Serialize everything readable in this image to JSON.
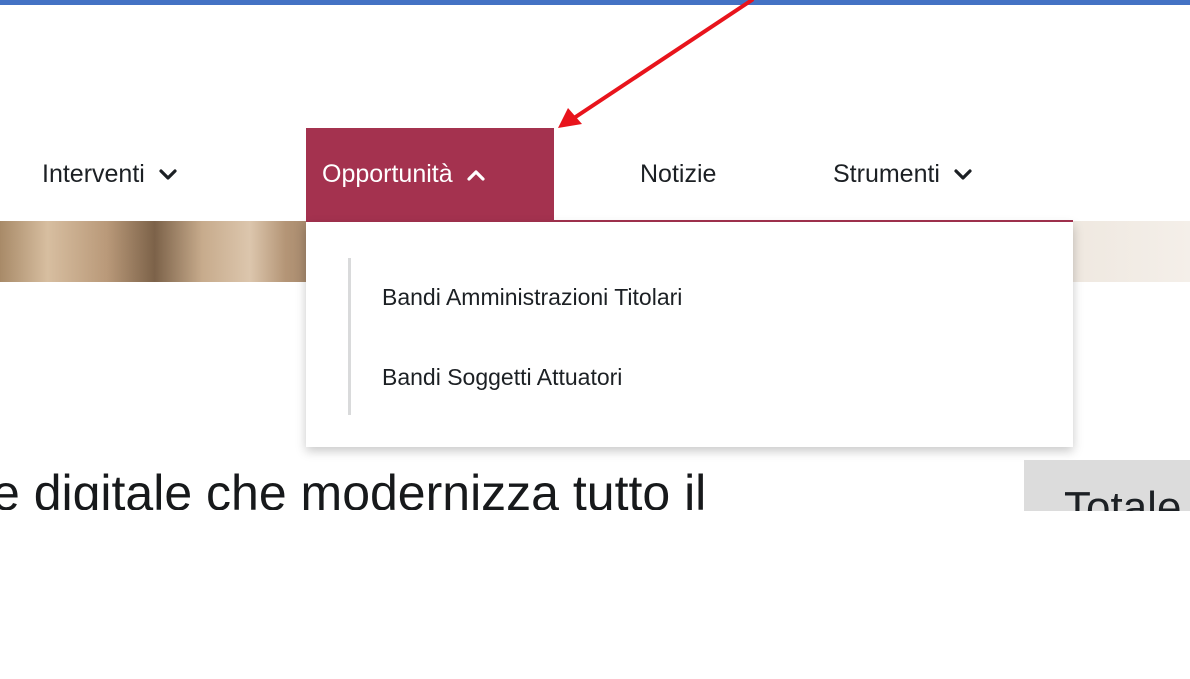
{
  "nav": {
    "items": [
      {
        "label": "Interventi",
        "chevron": "chevron-down-icon",
        "active": false
      },
      {
        "label": "Opportunità",
        "chevron": "chevron-up-icon",
        "active": true
      },
      {
        "label": "Notizie",
        "chevron": "",
        "active": false
      },
      {
        "label": "Strumenti",
        "chevron": "chevron-down-icon",
        "active": false
      }
    ]
  },
  "dropdown": {
    "items": [
      {
        "label": "Bandi Amministrazioni Titolari"
      },
      {
        "label": "Bandi Soggetti Attuatori"
      }
    ]
  },
  "content": {
    "headline_fragment": "e digitale che modernizza tutto il",
    "side_box_fragment": "Totale"
  },
  "colors": {
    "active_nav": "#a4324f",
    "annotation_arrow": "#e8141c",
    "top_border": "#4472c4"
  }
}
